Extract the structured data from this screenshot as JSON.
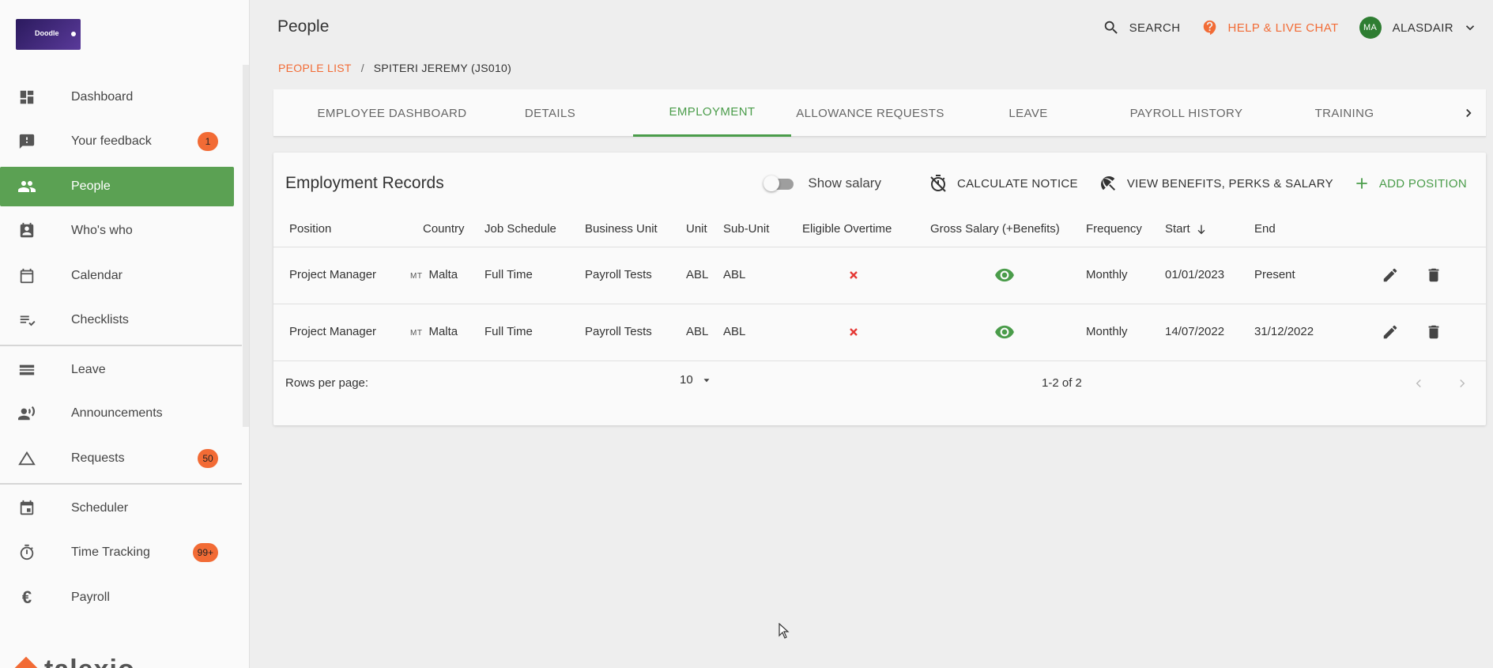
{
  "app": {
    "logo_text": "Doodle"
  },
  "sidebar": {
    "items": [
      {
        "label": "Dashboard",
        "icon": "dashboard-icon"
      },
      {
        "label": "Your feedback",
        "icon": "feedback-icon",
        "badge": "1"
      },
      {
        "label": "People",
        "icon": "people-icon",
        "active": true
      },
      {
        "label": "Who's who",
        "icon": "badge-icon"
      },
      {
        "label": "Calendar",
        "icon": "calendar-icon"
      },
      {
        "label": "Checklists",
        "icon": "checklist-icon"
      },
      {
        "label": "Leave",
        "icon": "leave-icon"
      },
      {
        "label": "Announcements",
        "icon": "announcement-icon"
      },
      {
        "label": "Requests",
        "icon": "requests-icon",
        "badge": "50"
      },
      {
        "label": "Scheduler",
        "icon": "scheduler-icon"
      },
      {
        "label": "Time Tracking",
        "icon": "timer-icon",
        "badge": "99+"
      },
      {
        "label": "Payroll",
        "icon": "euro-icon"
      }
    ],
    "brand": "talexio"
  },
  "header": {
    "title": "People",
    "search_label": "SEARCH",
    "help_label": "HELP & LIVE CHAT",
    "user_initials": "MA",
    "user_name": "ALASDAIR"
  },
  "breadcrumb": {
    "parent": "PEOPLE LIST",
    "separator": "/",
    "current": "SPITERI JEREMY (JS010)"
  },
  "tabs": [
    {
      "label": "EMPLOYEE DASHBOARD"
    },
    {
      "label": "DETAILS"
    },
    {
      "label": "EMPLOYMENT",
      "active": true
    },
    {
      "label": "ALLOWANCE REQUESTS"
    },
    {
      "label": "LEAVE"
    },
    {
      "label": "PAYROLL HISTORY"
    },
    {
      "label": "TRAINING"
    }
  ],
  "records": {
    "title": "Employment Records",
    "show_salary_label": "Show salary",
    "show_salary_on": false,
    "calculate_notice_label": "CALCULATE NOTICE",
    "view_benefits_label": "VIEW BENEFITS, PERKS & SALARY",
    "add_position_label": "ADD POSITION",
    "columns": [
      "Position",
      "Country",
      "Job Schedule",
      "Business Unit",
      "Unit",
      "Sub-Unit",
      "Eligible Overtime",
      "Gross Salary (+Benefits)",
      "Frequency",
      "Start",
      "End"
    ],
    "rows": [
      {
        "position": "Project Manager",
        "country_code": "MT",
        "country": "Malta",
        "schedule": "Full Time",
        "business_unit": "Payroll Tests",
        "unit": "ABL",
        "sub_unit": "ABL",
        "overtime": "no",
        "frequency": "Monthly",
        "start": "01/01/2023",
        "end": "Present"
      },
      {
        "position": "Project Manager",
        "country_code": "MT",
        "country": "Malta",
        "schedule": "Full Time",
        "business_unit": "Payroll Tests",
        "unit": "ABL",
        "sub_unit": "ABL",
        "overtime": "no",
        "frequency": "Monthly",
        "start": "14/07/2022",
        "end": "31/12/2022"
      }
    ],
    "rows_per_page_label": "Rows per page:",
    "rows_per_page": "10",
    "range": "1-2 of 2"
  },
  "colors": {
    "accent_green": "#5ba153",
    "accent_orange": "#f26b35",
    "error_red": "#e53935"
  }
}
